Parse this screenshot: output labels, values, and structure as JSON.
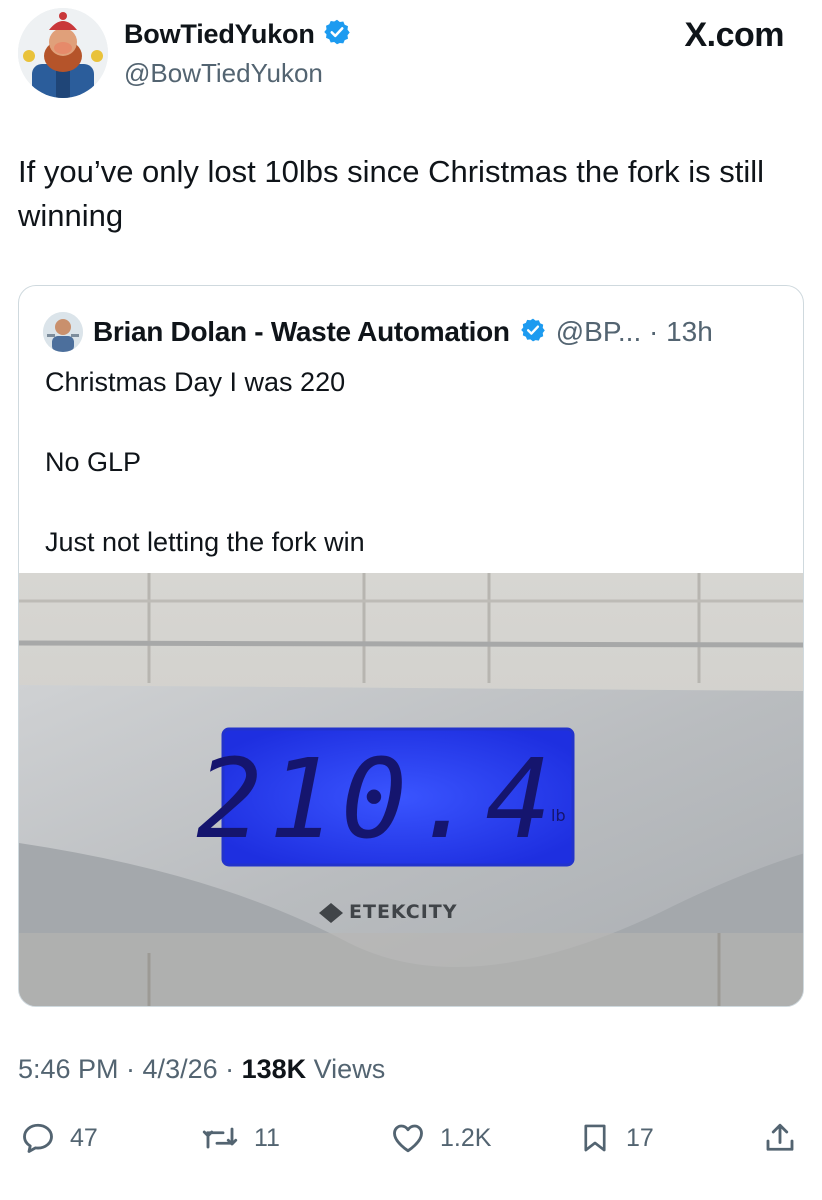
{
  "author": {
    "display_name": "BowTiedYukon",
    "handle": "@BowTiedYukon",
    "verified": true
  },
  "site": "X.com",
  "tweet_text": "If you’ve only lost 10lbs since Christmas the fork is still winning",
  "quoted": {
    "display_name": "Brian Dolan - Waste Automation",
    "verified": true,
    "meta": "@BP... · 13h",
    "lines": [
      "Christmas Day I was 220",
      "No GLP",
      "Just not letting the fork win"
    ],
    "photo": {
      "scale_reading": "210.4",
      "unit": "lb",
      "brand": "ETEKCITY"
    }
  },
  "timestamp": {
    "time_date": "5:46 PM · 4/3/26 · ",
    "views_count": "138K",
    "views_label": " Views"
  },
  "actions": {
    "replies": "47",
    "reposts": "11",
    "likes": "1.2K",
    "bookmarks": "17"
  },
  "colors": {
    "verified_blue": "#1d9bf0",
    "secondary_text": "#536471",
    "lcd_blue": "#2a3bff"
  },
  "icons": [
    "verified-badge-icon",
    "reply-icon",
    "repost-icon",
    "like-icon",
    "bookmark-icon",
    "share-icon"
  ]
}
